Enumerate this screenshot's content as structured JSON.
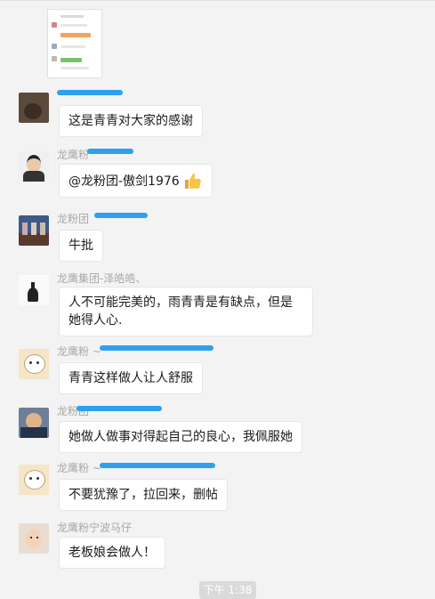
{
  "messages": [
    {
      "name": "",
      "text": "这是青青对大家的感谢"
    },
    {
      "name": "龙鹰粉",
      "text": "@龙粉团-傲剑1976"
    },
    {
      "name": "龙粉团",
      "text": "牛批"
    },
    {
      "name": "龙鹰集团-泽皓皓、",
      "text": "人不可能完美的，雨青青是有缺点，但是她得人心."
    },
    {
      "name": "龙鹰粉 ~",
      "text": "青青这样做人让人舒服"
    },
    {
      "name": "龙粉团",
      "text": "她做人做事对得起自己的良心，我佩服她"
    },
    {
      "name": "龙鹰粉 ~",
      "text": "不要犹豫了，拉回来，删帖"
    },
    {
      "name": "龙鹰粉宁波马仔",
      "text": "老板娘会做人！"
    }
  ],
  "timestamp": "下午 1:38",
  "icons": {
    "thumbs_up": "thumbs-up-emoji"
  },
  "colors": {
    "background": "#f3f3f3",
    "bubble": "#ffffff",
    "scribble": "#2ea0ef",
    "name": "#a8a8a8"
  }
}
